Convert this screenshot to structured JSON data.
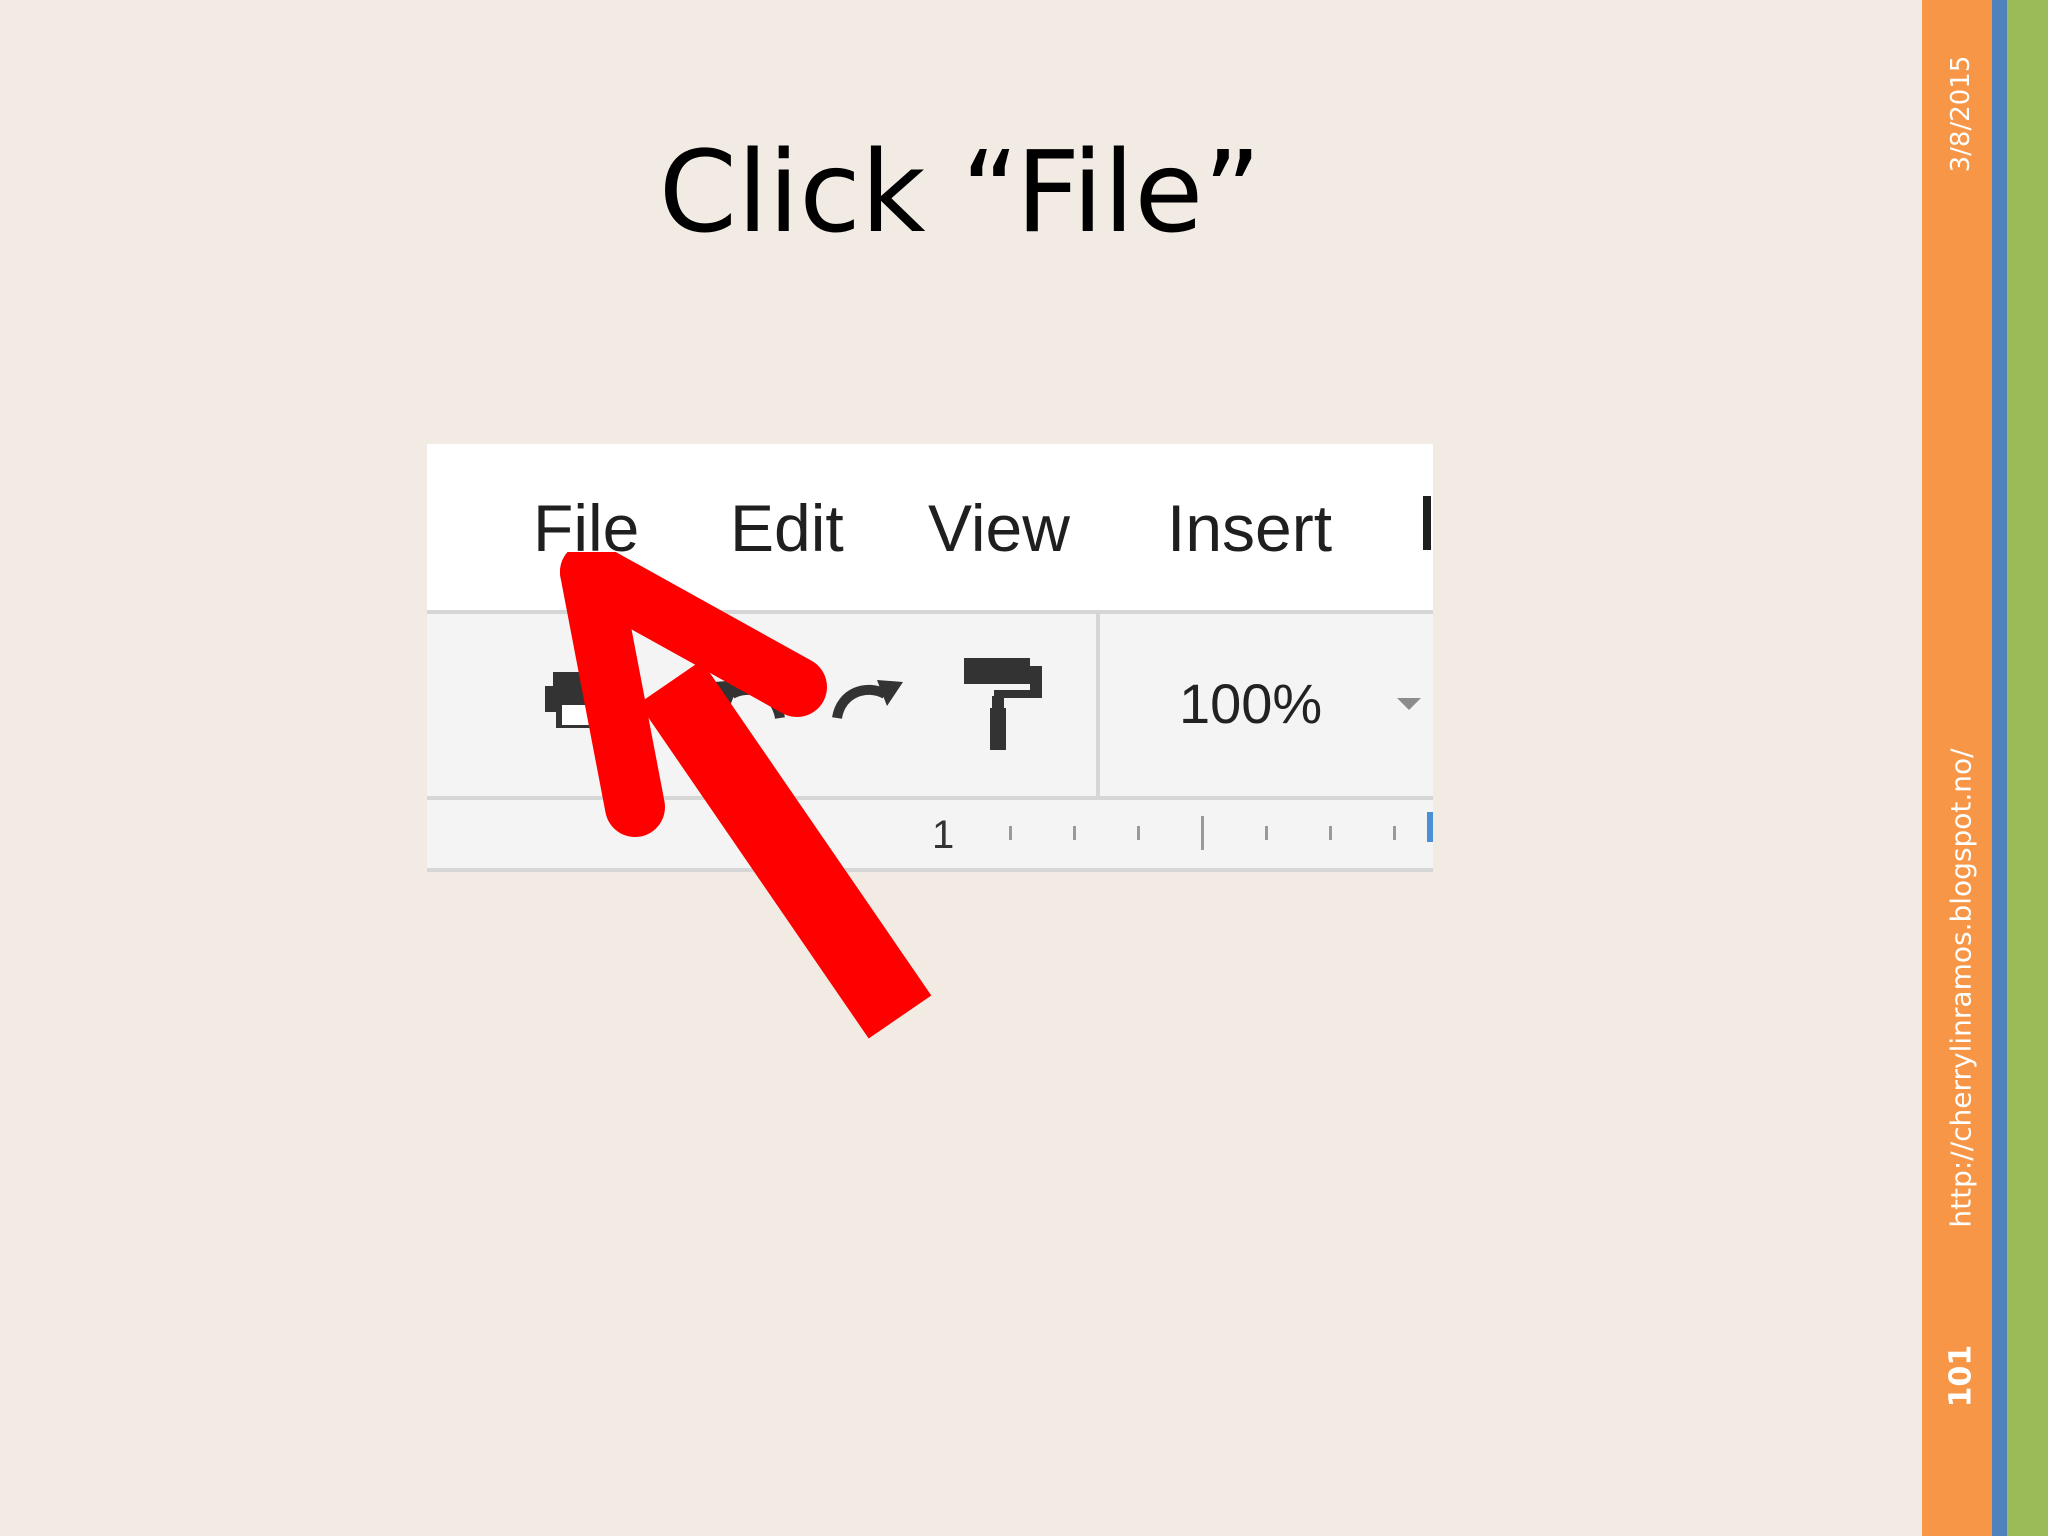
{
  "slide": {
    "title": "Click “File”",
    "date": "3/8/2015",
    "url": "http://cherrylinramos.blogspot.no/",
    "page_number": "101"
  },
  "menu": {
    "items": [
      "File",
      "Edit",
      "View",
      "Insert"
    ]
  },
  "toolbar": {
    "zoom": "100%"
  },
  "ruler": {
    "label": "1"
  },
  "colors": {
    "background": "#f2ebe4",
    "bar_orange": "#f79646",
    "bar_blue": "#4f81bd",
    "bar_green": "#9bbb59",
    "arrow": "#ff0000"
  },
  "icons": [
    "print-icon",
    "undo-icon",
    "redo-icon",
    "paint-format-icon",
    "dropdown-arrow-icon",
    "arrow-pointer-icon"
  ]
}
